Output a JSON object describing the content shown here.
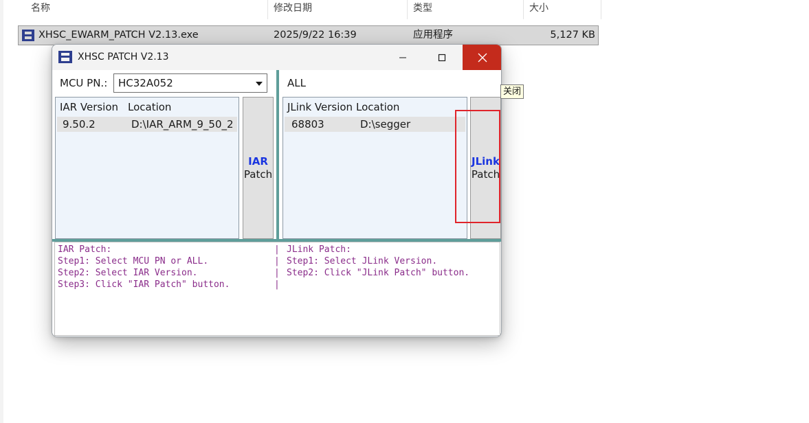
{
  "explorer": {
    "columns": [
      "名称",
      "修改日期",
      "类型",
      "大小"
    ],
    "file": {
      "name": "XHSC_EWARM_PATCH V2.13.exe",
      "modified": "2025/9/22 16:39",
      "type": "应用程序",
      "size": "5,127 KB"
    }
  },
  "dialog": {
    "title": "XHSC PATCH V2.13",
    "minimize_icon": "minimize-icon",
    "maximize_icon": "maximize-icon",
    "close_icon": "close-icon",
    "close_tooltip": "关闭",
    "close_color": "#c42b1c",
    "mcu_label": "MCU PN.:",
    "mcu_value": "HC32A052",
    "all_label": "ALL",
    "iar_list": {
      "headers": [
        "IAR Version",
        "Location"
      ],
      "rows": [
        {
          "version": "9.50.2",
          "location": "D:\\IAR_ARM_9_50_2"
        }
      ]
    },
    "jlink_list": {
      "headers": [
        "JLink Version",
        "Location"
      ],
      "rows": [
        {
          "version": "68803",
          "location": "D:\\segger"
        }
      ]
    },
    "iar_button": {
      "line1": "IAR",
      "line2": "Patch"
    },
    "jlink_button": {
      "line1": "JLink",
      "line2": "Patch"
    },
    "log": {
      "left": [
        "IAR Patch:",
        "Step1: Select MCU PN or ALL.",
        "Step2: Select IAR Version.",
        "Step3: Click \"IAR Patch\" button."
      ],
      "separators": [
        "|",
        "|",
        "|",
        "|"
      ],
      "right": [
        "JLink Patch:",
        "Step1: Select JLink Version.",
        "Step2: Click \"JLink Patch\" button."
      ]
    },
    "accent_color": "#1a35e0",
    "log_color": "#8a2c8a",
    "divider_color": "#5f9e9a"
  }
}
